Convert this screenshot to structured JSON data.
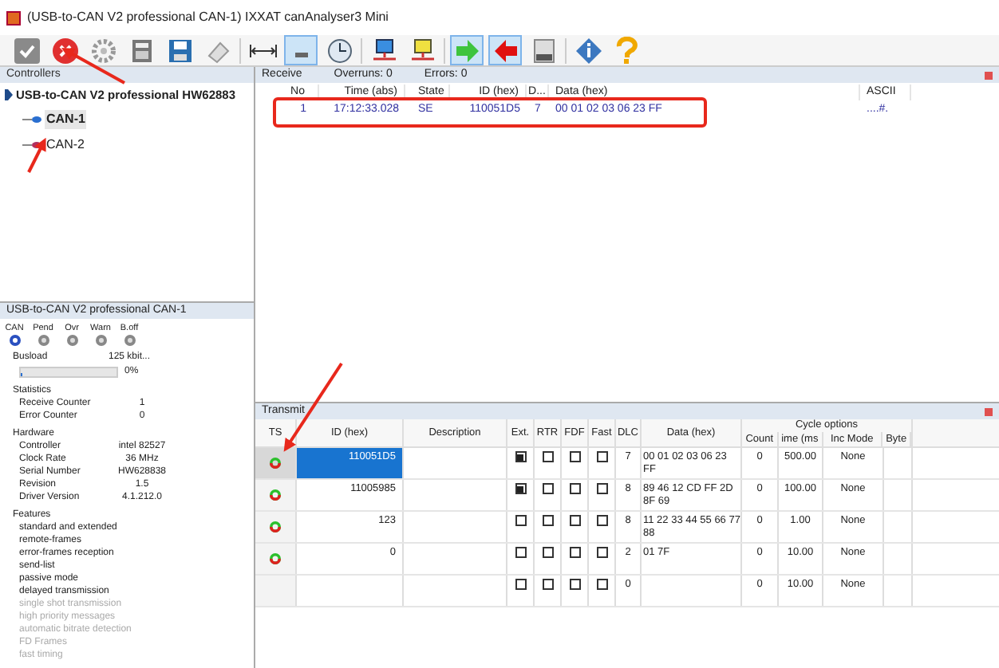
{
  "window": {
    "title": "(USB-to-CAN V2 professional  CAN-1) IXXAT canAnalyser3 Mini"
  },
  "toolbar": [
    {
      "kind": "check",
      "selected": false
    },
    {
      "kind": "stop",
      "selected": false
    },
    {
      "kind": "gear",
      "selected": false
    },
    {
      "kind": "calc",
      "selected": false
    },
    {
      "kind": "save",
      "selected": false
    },
    {
      "kind": "eraser",
      "selected": false
    },
    {
      "kind": "sep"
    },
    {
      "kind": "width",
      "selected": false
    },
    {
      "kind": "tray",
      "selected": true
    },
    {
      "kind": "clock",
      "selected": false
    },
    {
      "kind": "sep"
    },
    {
      "kind": "netblue",
      "selected": false
    },
    {
      "kind": "netyellow",
      "selected": false
    },
    {
      "kind": "sep"
    },
    {
      "kind": "greenarrow",
      "selected": true
    },
    {
      "kind": "redarrow",
      "selected": true
    },
    {
      "kind": "log",
      "selected": false
    },
    {
      "kind": "sep"
    },
    {
      "kind": "info",
      "selected": false
    },
    {
      "kind": "help",
      "selected": false
    }
  ],
  "controllers": {
    "title": "Controllers",
    "device": "USB-to-CAN V2 professional  HW62883",
    "children": [
      {
        "label": "CAN-1",
        "selected": true
      },
      {
        "label": "CAN-2",
        "selected": false
      }
    ]
  },
  "info": {
    "title": "USB-to-CAN V2 professional  CAN-1",
    "leds": [
      {
        "label": "CAN",
        "on": true
      },
      {
        "label": "Pend",
        "on": false
      },
      {
        "label": "Ovr",
        "on": false
      },
      {
        "label": "Warn",
        "on": false
      },
      {
        "label": "B.off",
        "on": false
      }
    ],
    "busload_label": "Busload",
    "bitrate": "125 kbit...",
    "busload": {
      "level": 0.02,
      "reading": "0%"
    },
    "sections": [
      {
        "title": "Statistics",
        "rows": [
          [
            "Receive Counter",
            "1"
          ],
          [
            "Error Counter",
            "0"
          ]
        ]
      },
      {
        "title": "Hardware",
        "rows": [
          [
            "Controller",
            "intel 82527"
          ],
          [
            "Clock Rate",
            "36 MHz"
          ],
          [
            "Serial Number",
            "HW628838"
          ],
          [
            "Revision",
            "1.5"
          ],
          [
            "Driver Version",
            "4.1.212.0"
          ]
        ]
      }
    ],
    "features_title": "Features",
    "features": [
      {
        "label": "standard and extended",
        "disabled": false
      },
      {
        "label": "remote-frames",
        "disabled": false
      },
      {
        "label": "error-frames reception",
        "disabled": false
      },
      {
        "label": "send-list",
        "disabled": false
      },
      {
        "label": "passive mode",
        "disabled": false
      },
      {
        "label": "delayed transmission",
        "disabled": false
      },
      {
        "label": "single shot transmission",
        "disabled": true
      },
      {
        "label": "high priority messages",
        "disabled": true
      },
      {
        "label": "automatic bitrate detection",
        "disabled": true
      },
      {
        "label": "FD Frames",
        "disabled": true
      },
      {
        "label": "fast timing",
        "disabled": true
      }
    ]
  },
  "receive": {
    "title": "Receive",
    "overruns": "Overruns: 0",
    "errors": "Errors: 0",
    "columns": [
      "No",
      "Time (abs)",
      "State",
      "ID (hex)",
      "D...",
      "Data (hex)",
      "ASCII"
    ],
    "rows": [
      [
        "1",
        "17:12:33.028",
        "SE",
        "110051D5",
        "7",
        "00 01 02 03 06 23 FF",
        "....#."
      ]
    ]
  },
  "transmit": {
    "title": "Transmit",
    "group": "Cycle options",
    "columns": [
      "TS",
      "ID (hex)",
      "Description",
      "Ext.",
      "RTR",
      "FDF",
      "Fast",
      "DLC",
      "Data (hex)",
      "Count",
      "ime (ms",
      "Inc Mode",
      "Byte"
    ],
    "rows": [
      {
        "selected": true,
        "icon": true,
        "id": "110051D5",
        "ext": true,
        "rtr": false,
        "fdf": false,
        "fast": false,
        "dlc": "7",
        "data": "00 01 02 03 06 23 FF",
        "count": "0",
        "time": "500.00",
        "mode": "None"
      },
      {
        "selected": false,
        "icon": true,
        "id": "11005985",
        "ext": true,
        "rtr": false,
        "fdf": false,
        "fast": false,
        "dlc": "8",
        "data": "89 46 12 CD FF 2D 8F 69",
        "count": "0",
        "time": "100.00",
        "mode": "None"
      },
      {
        "selected": false,
        "icon": true,
        "id": "123",
        "ext": false,
        "rtr": false,
        "fdf": false,
        "fast": false,
        "dlc": "8",
        "data": "11 22 33 44 55 66 77 88",
        "count": "0",
        "time": "1.00",
        "mode": "None"
      },
      {
        "selected": false,
        "icon": true,
        "id": "0",
        "ext": false,
        "rtr": false,
        "fdf": false,
        "fast": false,
        "dlc": "2",
        "data": "01 7F",
        "count": "0",
        "time": "10.00",
        "mode": "None"
      },
      {
        "selected": false,
        "icon": false,
        "id": "",
        "ext": false,
        "rtr": false,
        "fdf": false,
        "fast": false,
        "dlc": "0",
        "data": "",
        "count": "0",
        "time": "10.00",
        "mode": "None"
      }
    ]
  }
}
